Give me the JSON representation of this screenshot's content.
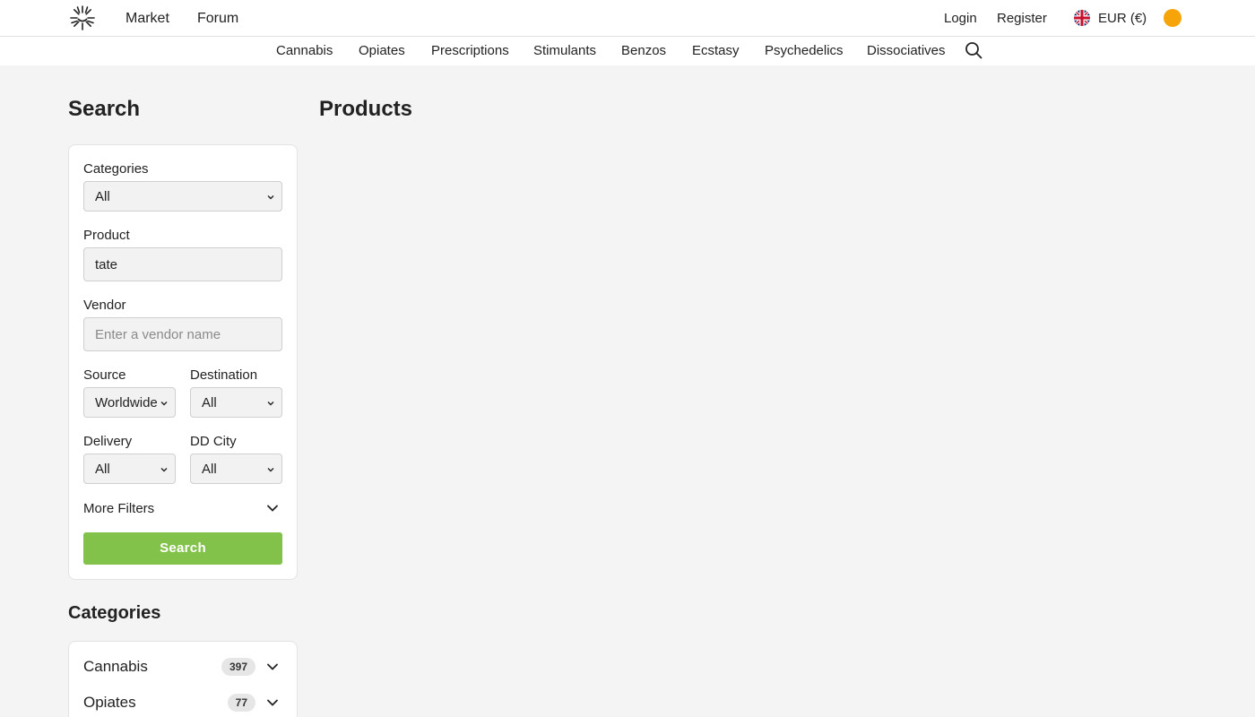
{
  "header": {
    "nav": [
      "Market",
      "Forum"
    ],
    "login": "Login",
    "register": "Register",
    "currency": "EUR (€)",
    "coin_color": "#f7a30a"
  },
  "category_nav": [
    "Cannabis",
    "Opiates",
    "Prescriptions",
    "Stimulants",
    "Benzos",
    "Ecstasy",
    "Psychedelics",
    "Dissociatives"
  ],
  "search_panel": {
    "title": "Search",
    "categories_label": "Categories",
    "categories_value": "All",
    "product_label": "Product",
    "product_value": "tate",
    "vendor_label": "Vendor",
    "vendor_placeholder": "Enter a vendor name",
    "source_label": "Source",
    "source_value": "Worldwide",
    "destination_label": "Destination",
    "destination_value": "All",
    "delivery_label": "Delivery",
    "delivery_value": "All",
    "ddcity_label": "DD City",
    "ddcity_value": "All",
    "more_filters": "More Filters",
    "search_button": "Search",
    "button_color": "#82c24a"
  },
  "main": {
    "title": "Products"
  },
  "categories_panel": {
    "title": "Categories",
    "items": [
      {
        "name": "Cannabis",
        "count": "397"
      },
      {
        "name": "Opiates",
        "count": "77"
      }
    ]
  }
}
